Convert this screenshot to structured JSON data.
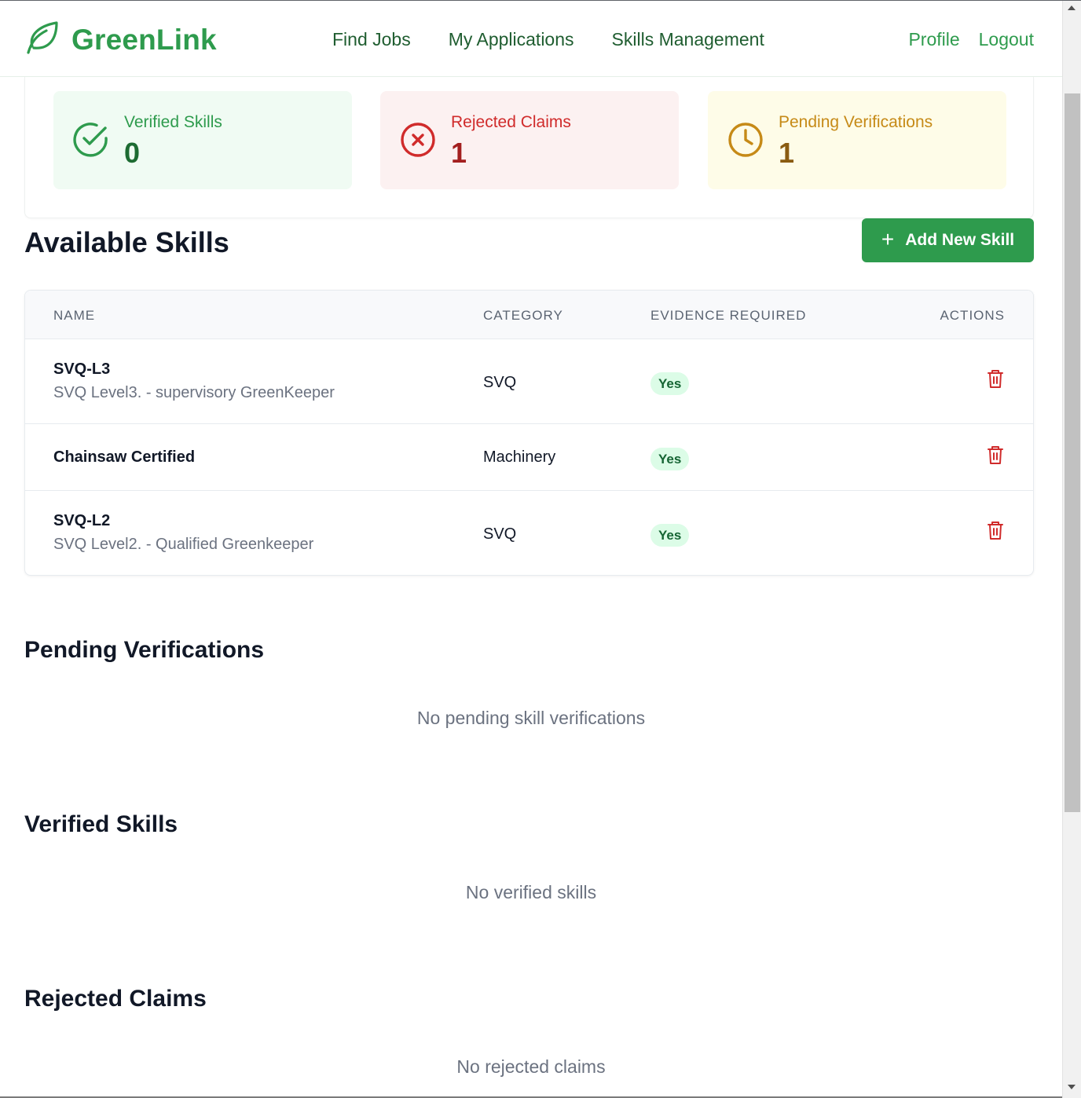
{
  "header": {
    "brand": "GreenLink",
    "nav": [
      {
        "label": "Find Jobs"
      },
      {
        "label": "My Applications"
      },
      {
        "label": "Skills Management"
      }
    ],
    "profile_label": "Profile",
    "logout_label": "Logout"
  },
  "stats": {
    "verified": {
      "label": "Verified Skills",
      "value": "0"
    },
    "rejected": {
      "label": "Rejected Claims",
      "value": "1"
    },
    "pending": {
      "label": "Pending Verifications",
      "value": "1"
    }
  },
  "available_skills": {
    "title": "Available Skills",
    "add_button_label": "Add New Skill",
    "columns": [
      "NAME",
      "CATEGORY",
      "EVIDENCE REQUIRED",
      "ACTIONS"
    ],
    "rows": [
      {
        "name": "SVQ-L3",
        "description": "SVQ Level3. - supervisory GreenKeeper",
        "category": "SVQ",
        "evidence": "Yes"
      },
      {
        "name": "Chainsaw Certified",
        "description": "",
        "category": "Machinery",
        "evidence": "Yes"
      },
      {
        "name": "SVQ-L2",
        "description": "SVQ Level2. - Qualified Greenkeeper",
        "category": "SVQ",
        "evidence": "Yes"
      }
    ]
  },
  "pending_section": {
    "title": "Pending Verifications",
    "empty": "No pending skill verifications"
  },
  "verified_section": {
    "title": "Verified Skills",
    "empty": "No verified skills"
  },
  "rejected_section": {
    "title": "Rejected Claims",
    "empty": "No rejected claims"
  },
  "colors": {
    "brand_green": "#2e9b4d",
    "danger_red": "#d02b2b",
    "warning_amber": "#c68a17",
    "badge_bg": "#dcfce7"
  },
  "icons": {
    "logo": "leaf-icon",
    "verified": "check-circle-icon",
    "rejected": "x-circle-icon",
    "pending": "clock-icon",
    "add": "plus-icon",
    "delete": "trash-icon"
  }
}
